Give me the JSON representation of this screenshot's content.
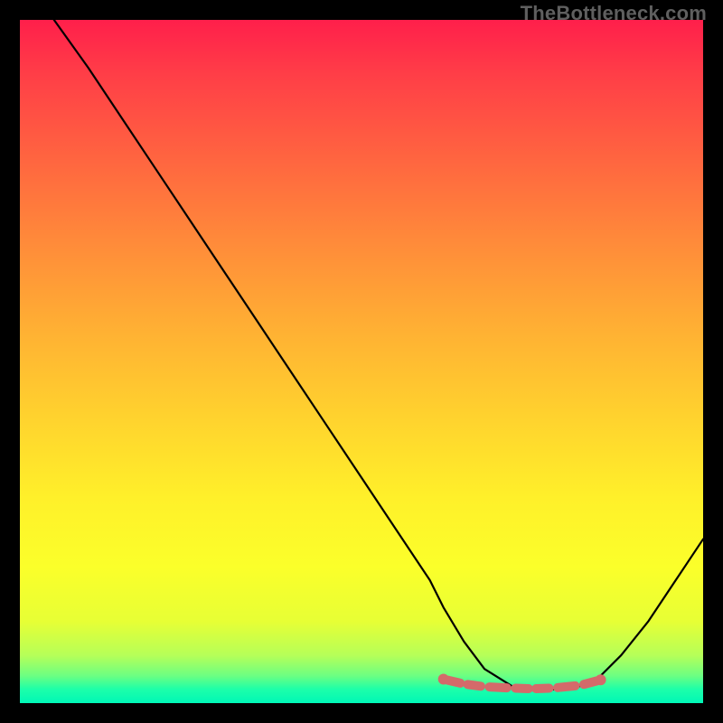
{
  "watermark": "TheBottleneck.com",
  "chart_data": {
    "type": "line",
    "title": "",
    "xlabel": "",
    "ylabel": "",
    "xlim": [
      0,
      100
    ],
    "ylim": [
      0,
      100
    ],
    "grid": false,
    "legend": false,
    "series": [
      {
        "name": "curve",
        "x": [
          5,
          10,
          15,
          20,
          25,
          30,
          35,
          40,
          45,
          50,
          55,
          60,
          62,
          65,
          68,
          72,
          75,
          78,
          82,
          85,
          88,
          92,
          96,
          100
        ],
        "y": [
          100,
          93,
          85.5,
          78,
          70.5,
          63,
          55.5,
          48,
          40.5,
          33,
          25.5,
          18,
          14,
          9,
          5,
          2.5,
          2,
          2,
          2.5,
          4,
          7,
          12,
          18,
          24
        ]
      }
    ],
    "highlight": {
      "name": "bottom-band",
      "x": [
        62,
        65,
        68,
        72,
        75,
        78,
        82,
        85
      ],
      "y": [
        3.5,
        2.8,
        2.4,
        2.2,
        2.1,
        2.2,
        2.6,
        3.4
      ]
    },
    "background_gradient": {
      "top": "#ff1f4b",
      "mid": "#ffd22e",
      "bottom": "#00f7b7"
    }
  }
}
